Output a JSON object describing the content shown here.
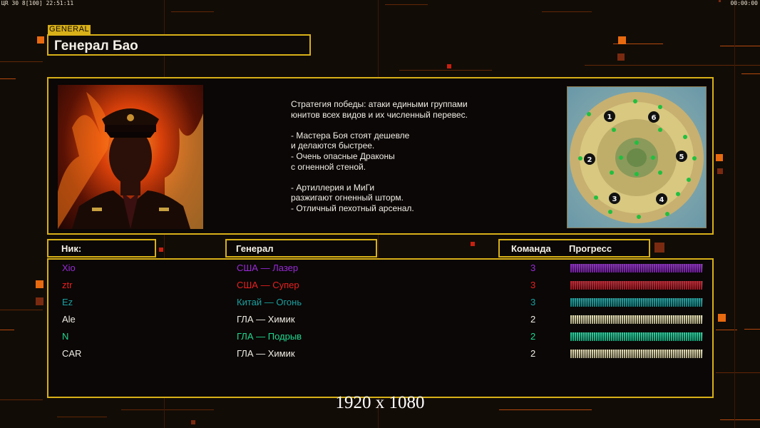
{
  "hud": {
    "left": "ЦR 30 8[100] 22:51:11",
    "right": "00:00:00"
  },
  "general_tag": "GENERAL",
  "title": "Генерал Бао",
  "description": "Стратегия победы: атаки едиными группами\nюнитов всех видов и их численный перевес.\n\n- Мастера Боя стоят дешевле\nи делаются быстрее.\n- Очень опасные Драконы\nс огненной стеной.\n\n- Артиллерия и МиГи\nразжигают огненный шторм.\n- Отличный пехотный арсенал.",
  "minimap": {
    "spawn_numbers": [
      "1",
      "6",
      "2",
      "5",
      "3",
      "4"
    ]
  },
  "table": {
    "headers": {
      "nick": "Ник:",
      "general": "Генерал",
      "team": "Команда",
      "progress": "Прогресс"
    },
    "rows": [
      {
        "nick": "Xio",
        "general": "США — Лазер",
        "team": "3",
        "color": "#9a2ad8",
        "bar_color": "#9a2ad8",
        "progress": 1.0
      },
      {
        "nick": "ztr",
        "general": "США — Супер",
        "team": "3",
        "color": "#e82020",
        "bar_color": "#d82030",
        "progress": 1.0
      },
      {
        "nick": "Ez",
        "general": "Китай — Огонь",
        "team": "3",
        "color": "#1aa0a0",
        "bar_color": "#1aa8a8",
        "progress": 1.0
      },
      {
        "nick": "Ale",
        "general": "ГЛА — Химик",
        "team": "2",
        "color": "#f0ece4",
        "bar_color": "#e8e0b0",
        "progress": 1.0
      },
      {
        "nick": "N",
        "general": "ГЛА — Подрыв",
        "team": "2",
        "color": "#20d890",
        "bar_color": "#20d8a0",
        "progress": 1.0
      },
      {
        "nick": "CAR",
        "general": "ГЛА — Химик",
        "team": "2",
        "color": "#f0ece4",
        "bar_color": "#e8e0b0",
        "progress": 1.0
      }
    ]
  },
  "caption": "1920 x 1080",
  "colors": {
    "frame": "#d8b018",
    "accent": "#e86a10",
    "background": "#120c06"
  }
}
